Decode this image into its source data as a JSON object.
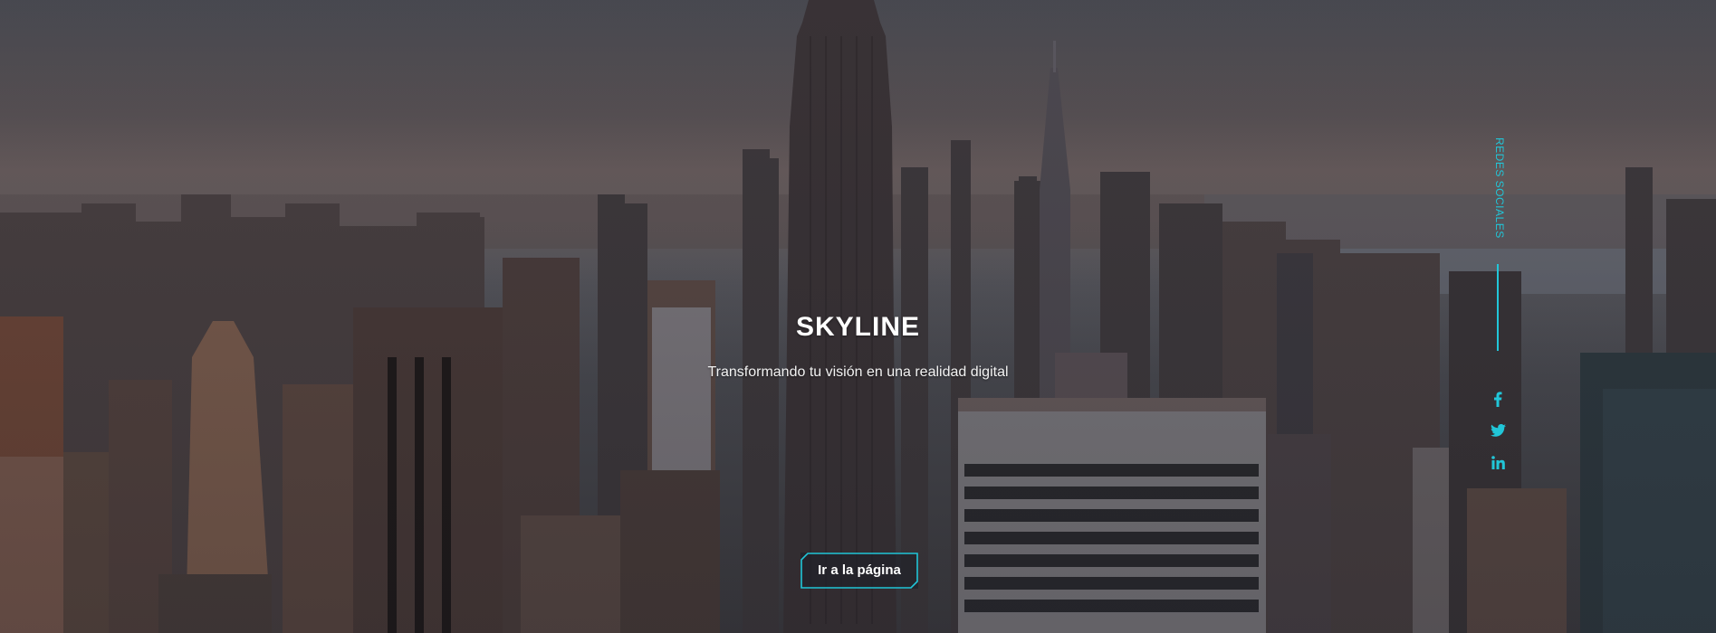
{
  "hero": {
    "title": "SKYLINE",
    "subtitle": "Transformando tu visión en una realidad digital",
    "cta_label": "Ir a la página"
  },
  "social": {
    "label": "REDES SOCIALES",
    "icons": [
      "facebook-icon",
      "twitter-icon",
      "linkedin-icon"
    ]
  },
  "colors": {
    "accent": "#21c6d8",
    "text": "#ffffff"
  }
}
